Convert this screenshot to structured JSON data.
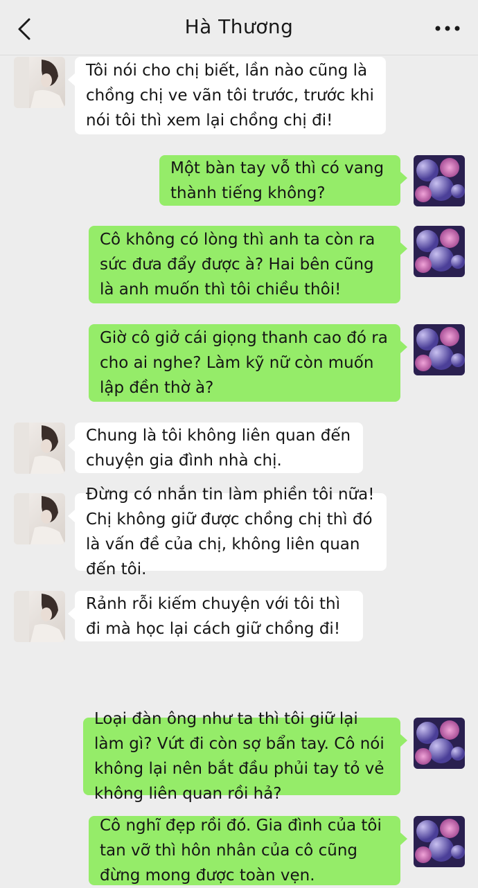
{
  "header": {
    "title": "Hà Thương",
    "back_icon": "chevron-left-icon",
    "more_icon": "more-dots-icon"
  },
  "colors": {
    "background": "#ededed",
    "incoming_bubble": "#ffffff",
    "outgoing_bubble": "#95ec69"
  },
  "messages": [
    {
      "side": "left",
      "avatar": "contact-avatar",
      "text": "Tôi nói cho chị biết, lần nào cũng là chồng chị ve vãn tôi trước, trước khi nói tôi thì xem lại chồng chị đi!"
    },
    {
      "side": "right",
      "avatar": "user-avatar",
      "text": "Một bàn tay vỗ thì có vang thành tiếng không?"
    },
    {
      "side": "right",
      "avatar": "user-avatar",
      "text": "Cô không có lòng thì anh ta còn ra sức đưa đẩy được à? Hai bên cũng là anh muốn thì tôi chiều thôi!"
    },
    {
      "side": "right",
      "avatar": "user-avatar",
      "text": "Giờ cô giở cái giọng thanh cao đó ra cho ai nghe? Làm kỹ nữ còn muốn lập đền thờ à?"
    },
    {
      "side": "left",
      "avatar": "contact-avatar",
      "text": "Chung là tôi không liên quan đến chuyện gia đình nhà chị."
    },
    {
      "side": "left",
      "avatar": "contact-avatar",
      "text": "Đừng có nhắn tin làm phiền tôi nữa! Chị không giữ được chồng chị thì đó là vấn đề của chị, không liên quan đến tôi."
    },
    {
      "side": "left",
      "avatar": "contact-avatar",
      "text": "Rảnh rỗi kiếm chuyện với tôi thì đi mà học lại cách giữ chồng đi!"
    },
    {
      "side": "right",
      "avatar": "user-avatar",
      "text": "Loại đàn ông như ta thì tôi giữ lại làm gì? Vứt đi còn sợ bẩn tay. Cô nói không lại nên bắt đầu phủi tay tỏ vẻ không liên quan rồi hả?"
    },
    {
      "side": "right",
      "avatar": "user-avatar",
      "text": "Cô nghĩ đẹp rồi đó. Gia đình của tôi tan vỡ thì hôn nhân của cô cũng đừng mong được toàn vẹn."
    }
  ]
}
